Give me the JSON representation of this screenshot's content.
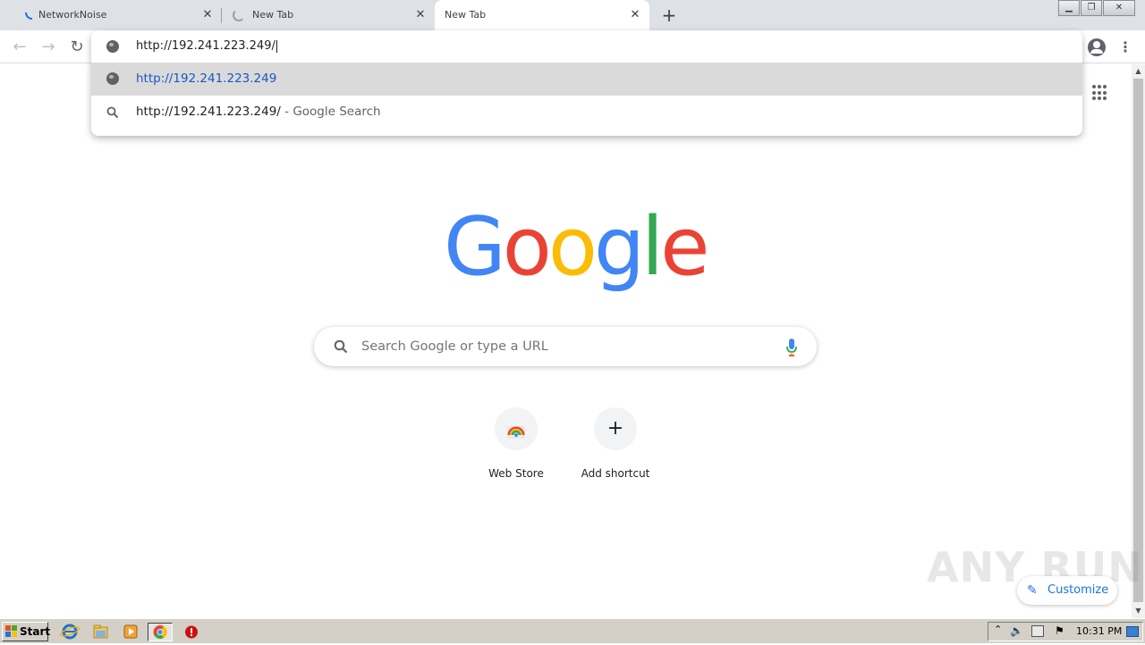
{
  "tabs": [
    {
      "title": "NetworkNoise",
      "state": "loading"
    },
    {
      "title": "New Tab",
      "state": "loading"
    },
    {
      "title": "New Tab",
      "state": "active"
    }
  ],
  "omnibox": {
    "input_value": "http://192.241.223.249/",
    "suggestions": [
      {
        "text": "http://192.241.223.249",
        "suffix": "",
        "icon": "globe-icon",
        "selected": true
      },
      {
        "text": "http://192.241.223.249/",
        "suffix": " - Google Search",
        "icon": "search-icon",
        "selected": false
      }
    ]
  },
  "ntp": {
    "logo": {
      "letters": [
        "G",
        "o",
        "o",
        "g",
        "l",
        "e"
      ],
      "colors": [
        "#4285f4",
        "#ea4335",
        "#fbbc05",
        "#4285f4",
        "#34a853",
        "#ea4335"
      ]
    },
    "search_placeholder": "Search Google or type a URL",
    "shortcuts": [
      {
        "label": "Web Store",
        "icon": "web-store-icon"
      },
      {
        "label": "Add shortcut",
        "icon": "plus-icon"
      }
    ],
    "customize_label": "Customize"
  },
  "watermark": "ANY RUN",
  "taskbar": {
    "start_label": "Start",
    "clock": "10:31 PM",
    "apps": [
      "internet-explorer-icon",
      "file-explorer-icon",
      "media-player-icon",
      "chrome-icon",
      "stop-icon"
    ]
  },
  "colors": {
    "tabstrip": "#dee1e6",
    "link": "#1a57c0",
    "accent": "#1a73e8",
    "taskbar": "#d4d0c8"
  }
}
